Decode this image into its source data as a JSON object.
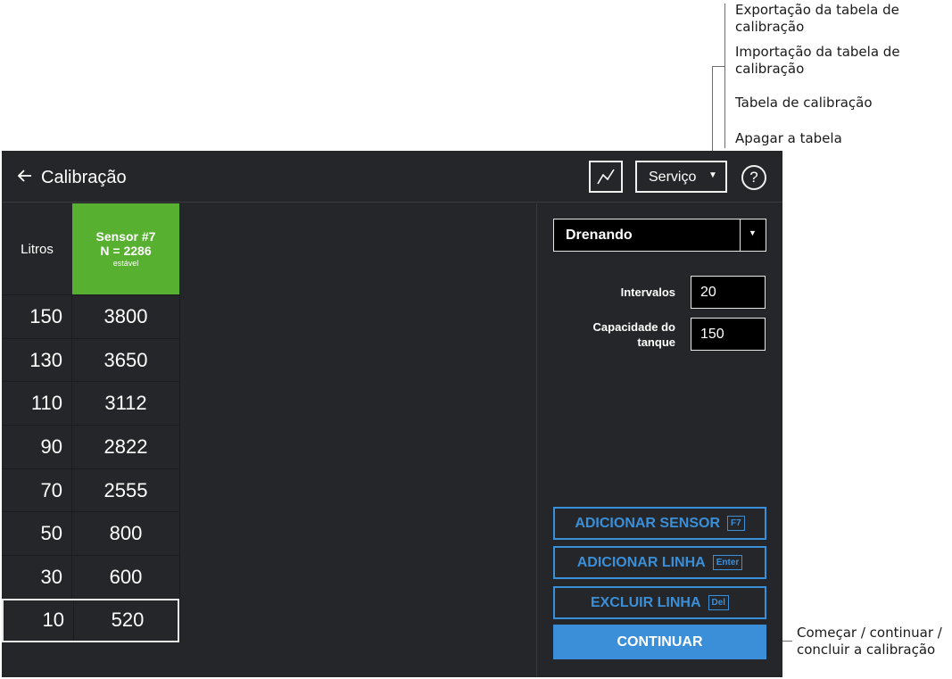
{
  "annotations": {
    "export_table": "Exportação da tabela de calibração",
    "import_table": "Importação da tabela de calibração",
    "calibration_table": "Tabela de calibração",
    "clear_table": "Apagar a tabela",
    "continue_note": "Começar / continuar / concluir a calibração"
  },
  "header": {
    "title": "Calibração",
    "service_label": "Serviço",
    "help_label": "?"
  },
  "table": {
    "col_litros": "Litros",
    "sensor": {
      "name": "Sensor #7",
      "n_value": "N = 2286",
      "state": "estável",
      "color": "#58b030"
    },
    "rows": [
      {
        "litros": "150",
        "value": "3800"
      },
      {
        "litros": "130",
        "value": "3650"
      },
      {
        "litros": "110",
        "value": "3112"
      },
      {
        "litros": "90",
        "value": "2822"
      },
      {
        "litros": "70",
        "value": "2555"
      },
      {
        "litros": "50",
        "value": "800"
      },
      {
        "litros": "30",
        "value": "600"
      },
      {
        "litros": "10",
        "value": "520"
      }
    ],
    "selected_row_index": 7
  },
  "panel": {
    "mode": "Drenando",
    "intervals_label": "Intervalos",
    "intervals_value": "20",
    "capacity_label_1": "Capacidade do",
    "capacity_label_2": "tanque",
    "capacity_value": "150",
    "add_sensor": {
      "label": "ADICIONAR SENSOR",
      "key": "F7"
    },
    "add_row": {
      "label": "ADICIONAR LINHA",
      "key": "Enter"
    },
    "delete_row": {
      "label": "EXCLUIR LINHA",
      "key": "Del"
    },
    "continue_label": "CONTINUAR"
  },
  "colors": {
    "app_bg": "#252629",
    "accent_blue": "#3a8fd9",
    "sensor_green": "#58b030"
  },
  "icons": {
    "back": "arrow-left-icon",
    "chart": "line-chart-icon",
    "help": "question-mark-icon",
    "service_dropdown": "caret-down-icon",
    "mode_dropdown": "caret-down-icon"
  }
}
